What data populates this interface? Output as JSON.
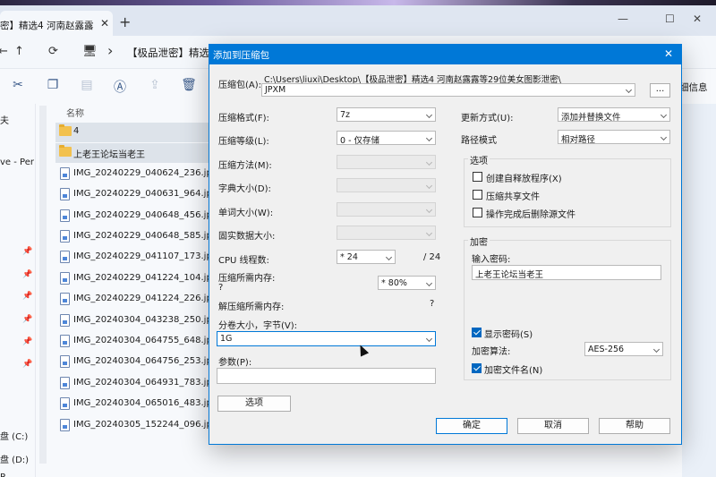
{
  "window": {
    "tab_title": "密】精选4 河南赵露露",
    "tab_close": "✕",
    "tab_add": "+",
    "minimize": "—",
    "maximize": "☐",
    "close": "✕"
  },
  "nav": {
    "back": "←",
    "forward": "→",
    "up": "↑",
    "refresh": "⟳",
    "pc": "🖥",
    "chevron": "›",
    "path_text": "【极品泄密】精选"
  },
  "toolbar": {
    "right_label": "细信息"
  },
  "sidebar": {
    "items": [
      {
        "text": "夫"
      },
      {
        "text": "ve - Per"
      },
      {
        "text": "盘 (C:)"
      },
      {
        "text": "盘 (D:)"
      },
      {
        "text": "R"
      }
    ]
  },
  "filelist": {
    "column_name": "名称",
    "items": [
      {
        "name": "4",
        "type": "folder"
      },
      {
        "name": "上老王论坛当老王",
        "type": "folder"
      },
      {
        "name": "IMG_20240229_040624_236.jpg",
        "type": "file"
      },
      {
        "name": "IMG_20240229_040631_964.jpg",
        "type": "file"
      },
      {
        "name": "IMG_20240229_040648_456.jpg",
        "type": "file"
      },
      {
        "name": "IMG_20240229_040648_585.jpg",
        "type": "file"
      },
      {
        "name": "IMG_20240229_041107_173.jpg",
        "type": "file"
      },
      {
        "name": "IMG_20240229_041224_104.jpg",
        "type": "file"
      },
      {
        "name": "IMG_20240229_041224_226.jpg",
        "type": "file"
      },
      {
        "name": "IMG_20240304_043238_250.jpg",
        "type": "file"
      },
      {
        "name": "IMG_20240304_064755_648.jpg",
        "type": "file"
      },
      {
        "name": "IMG_20240304_064756_253.jpg",
        "type": "file"
      },
      {
        "name": "IMG_20240304_064931_783.jpg",
        "type": "file"
      },
      {
        "name": "IMG_20240304_065016_483.jpg",
        "type": "file"
      },
      {
        "name": "IMG_20240305_152244_096.jpg",
        "type": "file"
      }
    ]
  },
  "dialog": {
    "title": "添加到压缩包",
    "close": "✕",
    "archive_label": "压缩包(A):",
    "archive_path": "C:\\Users\\liuxi\\Desktop\\【极品泄密】精选4 河南赵露露等29位美女图影泄密\\",
    "archive_name": "JPXM",
    "browse": "...",
    "format_label": "压缩格式(F):",
    "format_value": "7z",
    "level_label": "压缩等级(L):",
    "level_value": "0 - 仅存储",
    "method_label": "压缩方法(M):",
    "dict_label": "字典大小(D):",
    "word_label": "单词大小(W):",
    "solid_label": "固实数据大小:",
    "threads_label": "CPU 线程数:",
    "threads_value": "* 24",
    "threads_total": "/ 24",
    "mem_label": "压缩所需内存:",
    "mem_q": "?",
    "mem_value": "* 80%",
    "decomp_label": "解压缩所需内存:",
    "decomp_q": "?",
    "volume_label": "分卷大小，字节(V):",
    "volume_value": "1G",
    "params_label": "参数(P):",
    "options_button": "选项",
    "update_label": "更新方式(U):",
    "update_value": "添加并替换文件",
    "pathmode_label": "路径模式",
    "pathmode_value": "相对路径",
    "options_group": "选项",
    "opt_sfx": "创建自释放程序(X)",
    "opt_shared": "压缩共享文件",
    "opt_delete": "操作完成后删除源文件",
    "enc_group": "加密",
    "pwd_label": "输入密码:",
    "pwd_value": "上老王论坛当老王",
    "show_pwd": "显示密码(S)",
    "enc_method_label": "加密算法:",
    "enc_method_value": "AES-256",
    "enc_names": "加密文件名(N)",
    "ok": "确定",
    "cancel": "取消",
    "help": "帮助"
  }
}
